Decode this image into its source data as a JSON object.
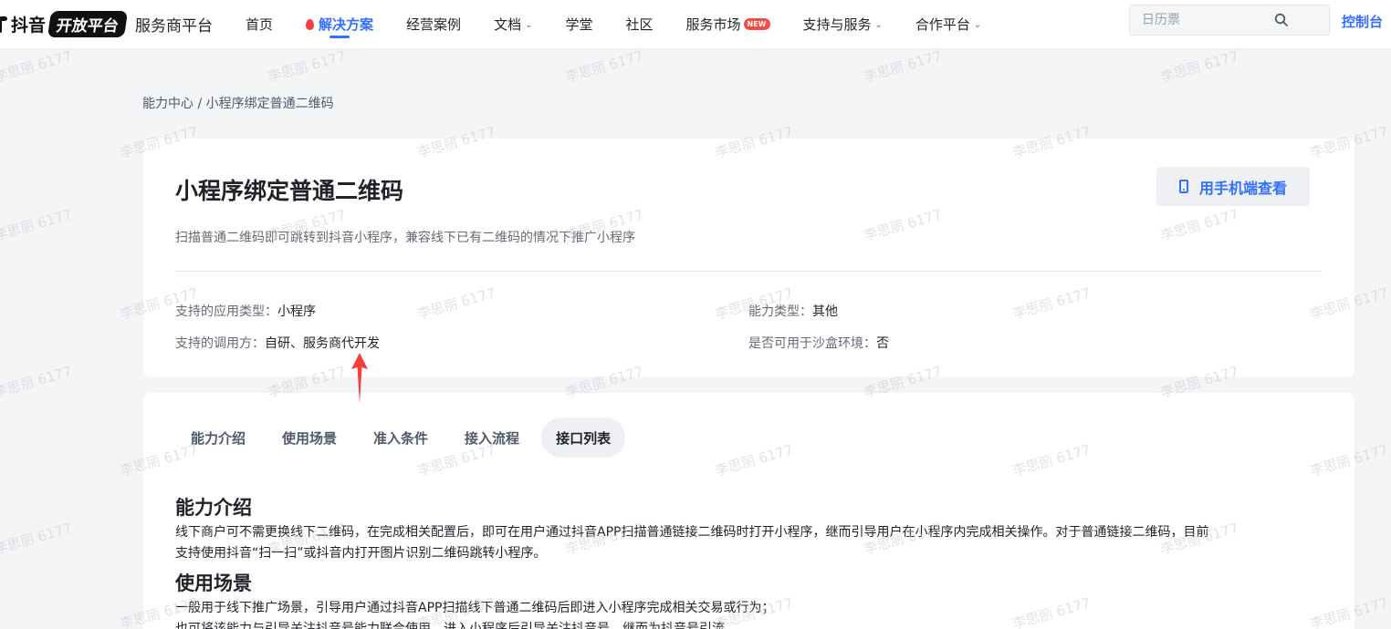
{
  "brand": {
    "name": "抖音",
    "badge": "开放平台",
    "sub": "服务商平台"
  },
  "nav": {
    "items": [
      {
        "label": "首页"
      },
      {
        "label": "解决方案"
      },
      {
        "label": "经营案例"
      },
      {
        "label": "文档"
      },
      {
        "label": "学堂"
      },
      {
        "label": "社区"
      },
      {
        "label": "服务市场"
      },
      {
        "label": "支持与服务"
      },
      {
        "label": "合作平台"
      }
    ],
    "new_badge": "NEW",
    "active": "解决方案"
  },
  "search": {
    "placeholder": "日历票",
    "value": ""
  },
  "console_label": "控制台",
  "breadcrumb": "能力中心 / 小程序绑定普通二维码",
  "header": {
    "title": "小程序绑定普通二维码",
    "mobile_button": "用手机端查看",
    "description": "扫描普通二维码即可跳转到抖音小程序，兼容线下已有二维码的情况下推广小程序",
    "meta": {
      "app_type_key": "支持的应用类型：",
      "app_type_value": "小程序",
      "ability_type_key": "能力类型：",
      "ability_type_value": "其他",
      "caller_key": "支持的调用方：",
      "caller_value": "自研、服务商代开发",
      "sandbox_key": "是否可用于沙盒环境：",
      "sandbox_value": "否"
    }
  },
  "tabs": [
    "能力介绍",
    "使用场景",
    "准入条件",
    "接入流程",
    "接口列表"
  ],
  "active_tab": "接口列表",
  "sections": {
    "intro_title": "能力介绍",
    "intro_line1": "线下商户可不需更换线下二维码，在完成相关配置后，即可在用户通过抖音APP扫描普通链接二维码时打开小程序，继而引导用户在小程序内完成相关操作。对于普通链接二维码，目前",
    "intro_line2": "支持使用抖音“扫一扫”或抖音内打开图片识别二维码跳转小程序。",
    "scene_title": "使用场景",
    "scene_line1": "一般用于线下推广场景，引导用户通过抖音APP扫描线下普通二维码后即进入小程序完成相关交易或行为；",
    "scene_line2": "也可将该能力与引导关注抖音号能力联合使用，进入小程序后引导关注抖音号，继而为抖音号引流"
  },
  "watermark": "李思丽 6177",
  "colors": {
    "accent": "#3370ff",
    "arrow": "#f53f3f",
    "new_badge": "#f54a45"
  }
}
